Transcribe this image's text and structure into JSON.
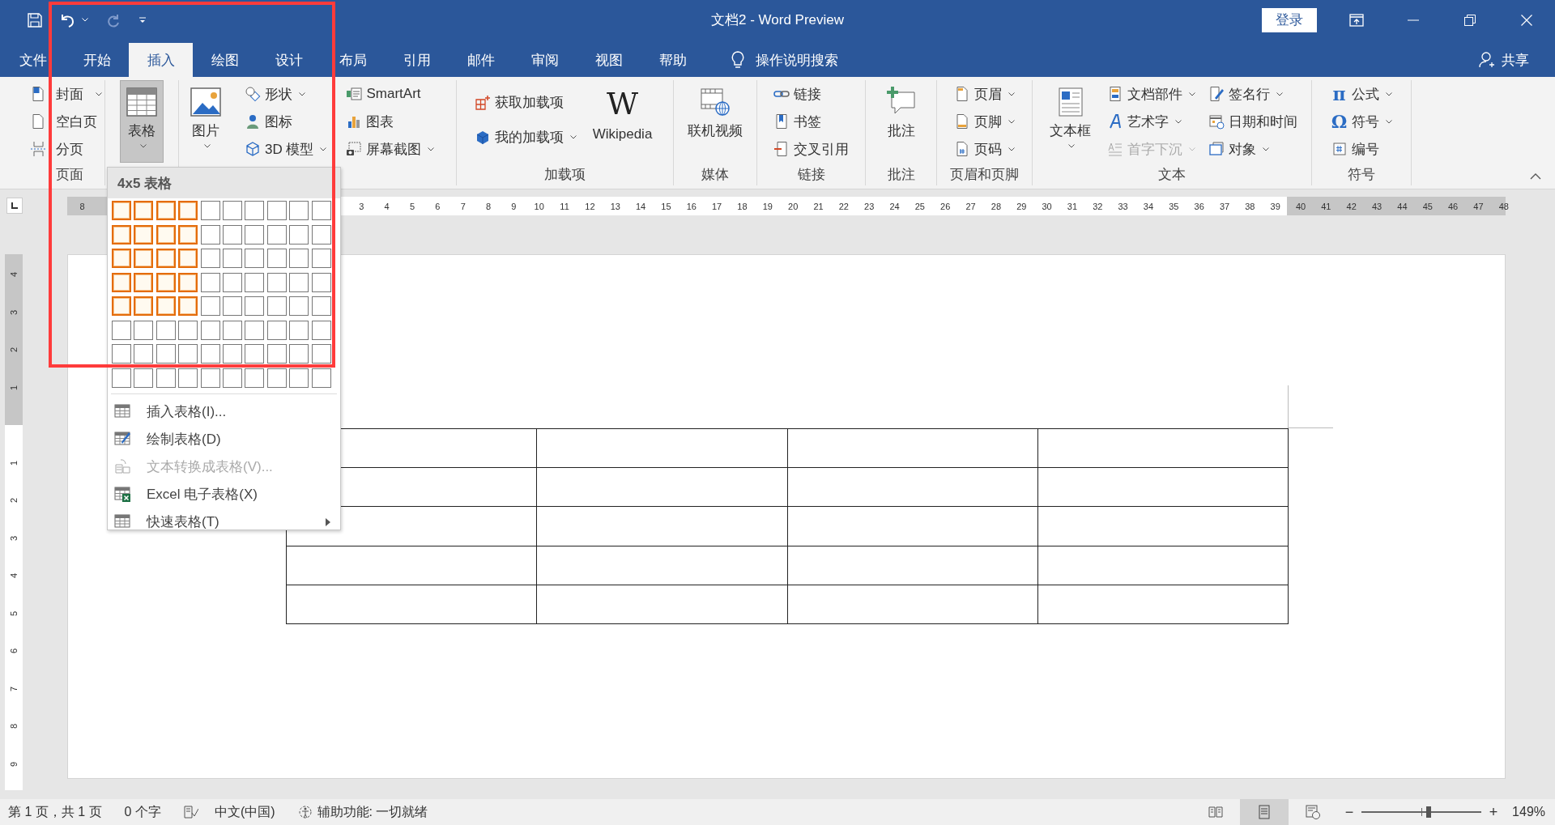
{
  "title_bar": {
    "title": "文档2 - Word Preview",
    "sign_in": "登录"
  },
  "tabs": [
    {
      "label": "文件",
      "selected": false
    },
    {
      "label": "开始",
      "selected": false
    },
    {
      "label": "插入",
      "selected": true
    },
    {
      "label": "绘图",
      "selected": false
    },
    {
      "label": "设计",
      "selected": false
    },
    {
      "label": "布局",
      "selected": false
    },
    {
      "label": "引用",
      "selected": false
    },
    {
      "label": "邮件",
      "selected": false
    },
    {
      "label": "审阅",
      "selected": false
    },
    {
      "label": "视图",
      "selected": false
    },
    {
      "label": "帮助",
      "selected": false
    }
  ],
  "tell_me": "操作说明搜索",
  "share": "共享",
  "ribbon_groups": [
    {
      "label": "页面",
      "columns": [
        {
          "kind": "stack",
          "items": [
            {
              "label": "封面",
              "dropdown": true,
              "disabled": false
            },
            {
              "label": "空白页",
              "dropdown": false,
              "disabled": false
            },
            {
              "label": "分页",
              "dropdown": false,
              "disabled": false
            }
          ]
        }
      ]
    },
    {
      "columns": [
        {
          "kind": "large",
          "items": [
            {
              "label": "表格",
              "dropdown": true,
              "pressed": true
            }
          ]
        }
      ]
    },
    {
      "columns": [
        {
          "kind": "large",
          "items": [
            {
              "label": "图片",
              "dropdown": true,
              "pressed": false
            }
          ]
        },
        {
          "kind": "stack",
          "items": [
            {
              "label": "形状",
              "dropdown": true,
              "disabled": false
            },
            {
              "label": "图标",
              "dropdown": false,
              "disabled": false
            },
            {
              "label": "3D 模型",
              "dropdown": true,
              "disabled": false
            }
          ]
        },
        {
          "kind": "stack",
          "items": [
            {
              "label": "SmartArt",
              "dropdown": false,
              "disabled": false
            },
            {
              "label": "图表",
              "dropdown": false,
              "disabled": false
            },
            {
              "label": "屏幕截图",
              "dropdown": true,
              "disabled": false
            }
          ]
        }
      ]
    },
    {
      "label": "加载项",
      "columns": [
        {
          "kind": "stack2",
          "items": [
            {
              "label": "获取加载项",
              "dropdown": false,
              "disabled": false
            },
            {
              "label": "我的加载项",
              "dropdown": true,
              "disabled": false
            }
          ]
        },
        {
          "kind": "large",
          "items": [
            {
              "label": "Wikipedia",
              "glyph": "W",
              "dropdown": false,
              "pressed": false
            }
          ]
        }
      ]
    },
    {
      "label": "媒体",
      "columns": [
        {
          "kind": "large",
          "items": [
            {
              "label": "联机视频",
              "dropdown": false,
              "pressed": false
            }
          ]
        }
      ]
    },
    {
      "label": "链接",
      "columns": [
        {
          "kind": "stack",
          "items": [
            {
              "label": "链接",
              "dropdown": false,
              "disabled": false
            },
            {
              "label": "书签",
              "dropdown": false,
              "disabled": false
            },
            {
              "label": "交叉引用",
              "dropdown": false,
              "disabled": false
            }
          ]
        }
      ]
    },
    {
      "label": "批注",
      "columns": [
        {
          "kind": "large",
          "items": [
            {
              "label": "批注",
              "dropdown": false,
              "pressed": false
            }
          ]
        }
      ]
    },
    {
      "label": "页眉和页脚",
      "columns": [
        {
          "kind": "stack",
          "items": [
            {
              "label": "页眉",
              "dropdown": true,
              "disabled": false
            },
            {
              "label": "页脚",
              "dropdown": true,
              "disabled": false
            },
            {
              "label": "页码",
              "dropdown": true,
              "disabled": false
            }
          ]
        }
      ]
    },
    {
      "label": "文本",
      "columns": [
        {
          "kind": "large",
          "items": [
            {
              "label": "文本框",
              "dropdown": true,
              "pressed": false
            }
          ]
        },
        {
          "kind": "stack",
          "items": [
            {
              "label": "文档部件",
              "dropdown": true,
              "disabled": false
            },
            {
              "label": "艺术字",
              "dropdown": true,
              "disabled": false
            },
            {
              "label": "首字下沉",
              "dropdown": true,
              "disabled": true
            }
          ]
        },
        {
          "kind": "stack",
          "items": [
            {
              "label": "签名行",
              "dropdown": true,
              "disabled": false
            },
            {
              "label": "日期和时间",
              "dropdown": false,
              "disabled": false
            },
            {
              "label": "对象",
              "dropdown": true,
              "disabled": false
            }
          ]
        }
      ]
    },
    {
      "label": "符号",
      "columns": [
        {
          "kind": "stack",
          "items": [
            {
              "label": "公式",
              "glyph": "π",
              "dropdown": true,
              "disabled": false
            },
            {
              "label": "符号",
              "glyph": "Ω",
              "dropdown": true,
              "disabled": false
            },
            {
              "label": "编号",
              "dropdown": false,
              "disabled": false
            }
          ]
        }
      ]
    }
  ],
  "ruler": {
    "left_labels": [
      "8"
    ],
    "right_labels": [
      "3",
      "4",
      "5",
      "6",
      "7",
      "8",
      "9",
      "10",
      "11",
      "12",
      "13",
      "14",
      "15",
      "16",
      "17",
      "18",
      "19",
      "20",
      "21",
      "22",
      "23",
      "24",
      "25",
      "26",
      "27",
      "28",
      "29",
      "30",
      "31",
      "32",
      "33",
      "34",
      "35",
      "36",
      "37",
      "38",
      "39",
      "40",
      "41",
      "42",
      "43",
      "44",
      "45",
      "46",
      "47",
      "48"
    ]
  },
  "vertical_ruler": {
    "top_labels": [
      "4",
      "3",
      "2",
      "1"
    ],
    "bottom_labels": [
      "1",
      "2",
      "3",
      "4",
      "5",
      "6",
      "7",
      "8",
      "9"
    ]
  },
  "document": {
    "table": {
      "rows": [
        {
          "cells": [
            {
              "kind": "empty"
            },
            {
              "kind": "empty"
            },
            {
              "kind": "empty"
            },
            {
              "kind": "empty"
            }
          ]
        },
        {
          "cells": [
            {
              "kind": "empty"
            },
            {
              "kind": "empty"
            },
            {
              "kind": "empty"
            },
            {
              "kind": "empty"
            }
          ]
        },
        {
          "cells": [
            {
              "kind": "empty"
            },
            {
              "kind": "empty"
            },
            {
              "kind": "empty"
            },
            {
              "kind": "empty"
            }
          ]
        },
        {
          "cells": [
            {
              "kind": "empty"
            },
            {
              "kind": "empty"
            },
            {
              "kind": "empty"
            },
            {
              "kind": "empty"
            }
          ]
        },
        {
          "cells": [
            {
              "kind": "empty"
            },
            {
              "kind": "empty"
            },
            {
              "kind": "empty"
            },
            {
              "kind": "empty"
            }
          ]
        }
      ]
    }
  },
  "table_menu": {
    "title": "4x5 表格",
    "grid": [
      {
        "cells": [
          {
            "selected": true
          },
          {
            "selected": true
          },
          {
            "selected": true
          },
          {
            "selected": true
          },
          {
            "selected": false
          },
          {
            "selected": false
          },
          {
            "selected": false
          },
          {
            "selected": false
          },
          {
            "selected": false
          },
          {
            "selected": false
          }
        ]
      },
      {
        "cells": [
          {
            "selected": true
          },
          {
            "selected": true
          },
          {
            "selected": true
          },
          {
            "selected": true
          },
          {
            "selected": false
          },
          {
            "selected": false
          },
          {
            "selected": false
          },
          {
            "selected": false
          },
          {
            "selected": false
          },
          {
            "selected": false
          }
        ]
      },
      {
        "cells": [
          {
            "selected": true
          },
          {
            "selected": true
          },
          {
            "selected": true
          },
          {
            "selected": true
          },
          {
            "selected": false
          },
          {
            "selected": false
          },
          {
            "selected": false
          },
          {
            "selected": false
          },
          {
            "selected": false
          },
          {
            "selected": false
          }
        ]
      },
      {
        "cells": [
          {
            "selected": true
          },
          {
            "selected": true
          },
          {
            "selected": true
          },
          {
            "selected": true
          },
          {
            "selected": false
          },
          {
            "selected": false
          },
          {
            "selected": false
          },
          {
            "selected": false
          },
          {
            "selected": false
          },
          {
            "selected": false
          }
        ]
      },
      {
        "cells": [
          {
            "selected": true
          },
          {
            "selected": true
          },
          {
            "selected": true
          },
          {
            "selected": true
          },
          {
            "selected": false
          },
          {
            "selected": false
          },
          {
            "selected": false
          },
          {
            "selected": false
          },
          {
            "selected": false
          },
          {
            "selected": false
          }
        ]
      },
      {
        "cells": [
          {
            "selected": false
          },
          {
            "selected": false
          },
          {
            "selected": false
          },
          {
            "selected": false
          },
          {
            "selected": false
          },
          {
            "selected": false
          },
          {
            "selected": false
          },
          {
            "selected": false
          },
          {
            "selected": false
          },
          {
            "selected": false
          }
        ]
      },
      {
        "cells": [
          {
            "selected": false
          },
          {
            "selected": false
          },
          {
            "selected": false
          },
          {
            "selected": false
          },
          {
            "selected": false
          },
          {
            "selected": false
          },
          {
            "selected": false
          },
          {
            "selected": false
          },
          {
            "selected": false
          },
          {
            "selected": false
          }
        ]
      },
      {
        "cells": [
          {
            "selected": false
          },
          {
            "selected": false
          },
          {
            "selected": false
          },
          {
            "selected": false
          },
          {
            "selected": false
          },
          {
            "selected": false
          },
          {
            "selected": false
          },
          {
            "selected": false
          },
          {
            "selected": false
          },
          {
            "selected": false
          }
        ]
      }
    ],
    "items": [
      {
        "label": "插入表格(I)...",
        "disabled": false,
        "submenu": false
      },
      {
        "label": "绘制表格(D)",
        "disabled": false,
        "submenu": false
      },
      {
        "label": "文本转换成表格(V)...",
        "disabled": true,
        "submenu": false
      },
      {
        "label": "Excel 电子表格(X)",
        "disabled": false,
        "submenu": false
      },
      {
        "label": "快速表格(T)",
        "disabled": false,
        "submenu": true
      }
    ]
  },
  "status_bar": {
    "page": "第 1 页，共 1 页",
    "words": "0 个字",
    "language": "中文(中国)",
    "accessibility": "辅助功能: 一切就绪",
    "views": [
      {
        "kind": "read",
        "selected": false
      },
      {
        "kind": "print",
        "selected": true
      },
      {
        "kind": "web",
        "selected": false
      }
    ],
    "zoom_out": "−",
    "zoom_in": "+",
    "zoom": {
      "level": 0.56,
      "reading": "149%"
    }
  },
  "annotation": {
    "kind": "rectangle",
    "color": "#ff3b3b"
  }
}
